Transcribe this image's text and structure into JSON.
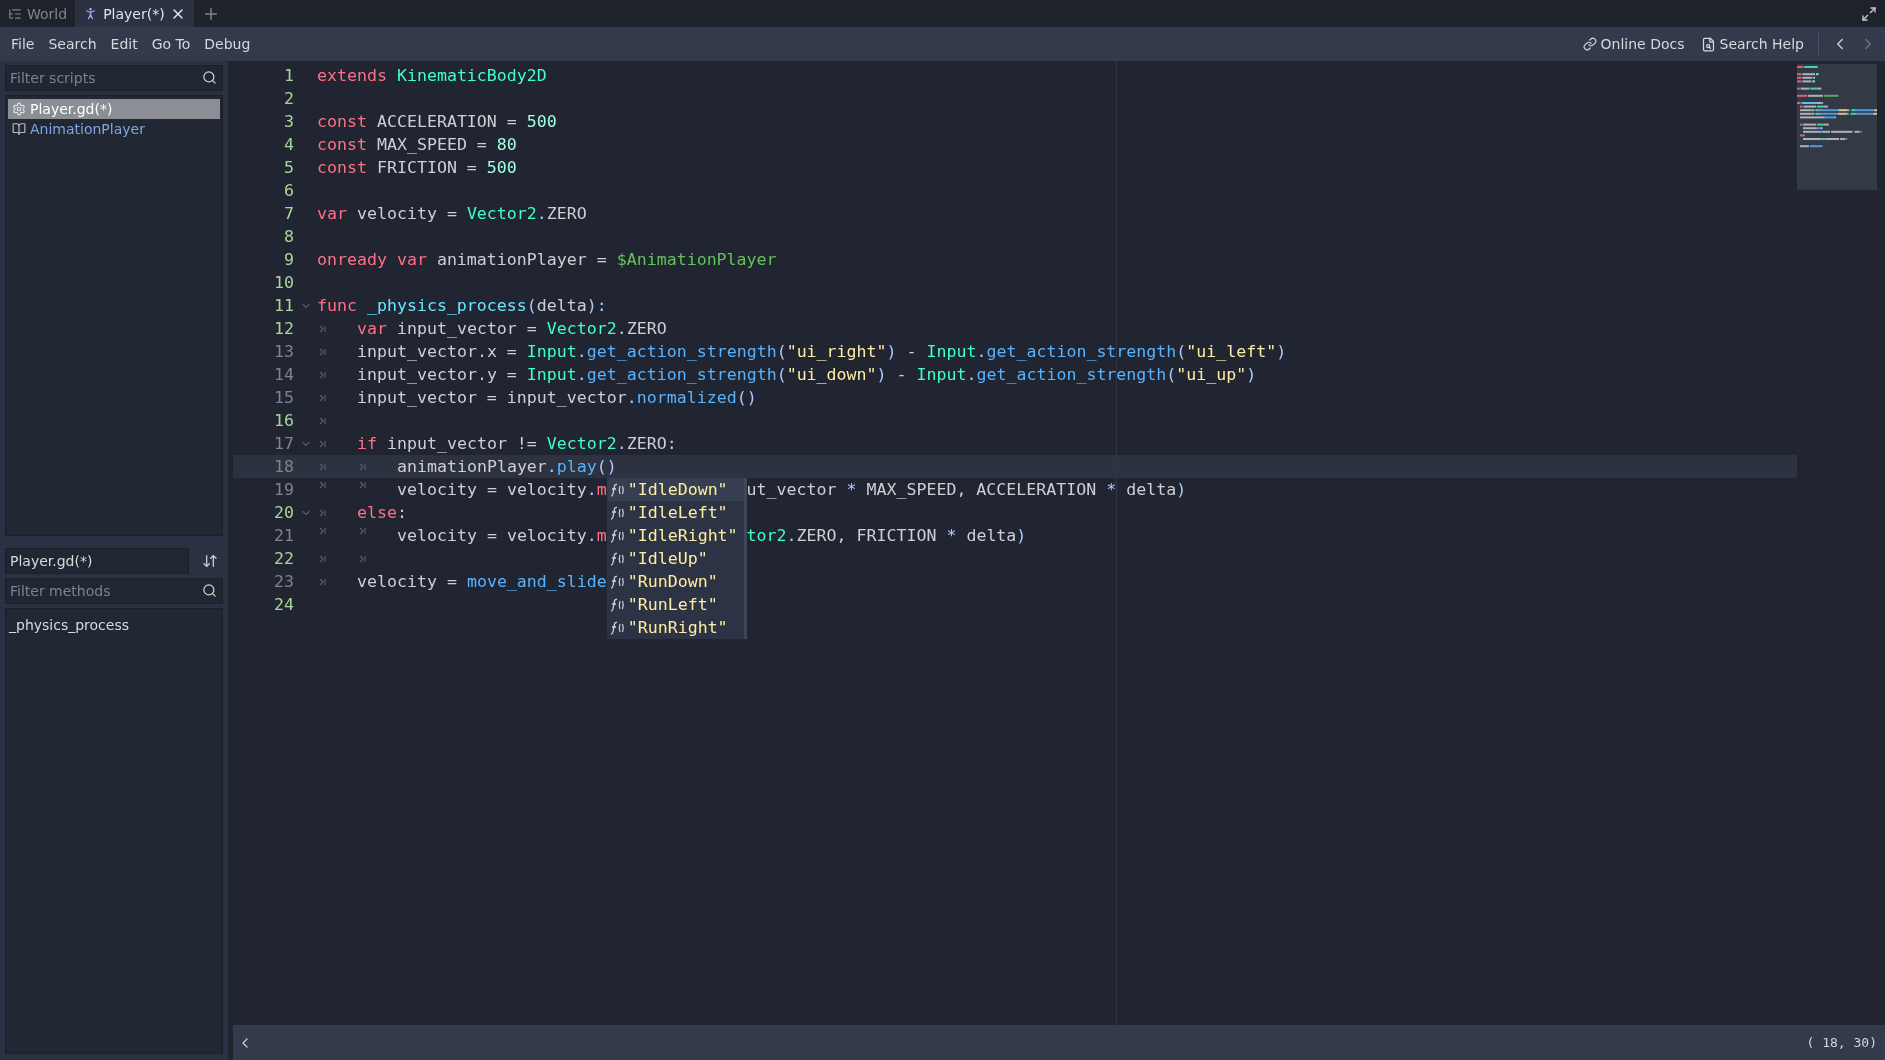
{
  "tabs": [
    {
      "label": "World",
      "kind": "scene3d",
      "selected": false,
      "closable": false
    },
    {
      "label": "Player(*)",
      "kind": "figure",
      "selected": true,
      "closable": true
    }
  ],
  "menu": [
    "File",
    "Search",
    "Edit",
    "Go To",
    "Debug"
  ],
  "help_links": [
    {
      "label": "Online Docs",
      "kind": "link"
    },
    {
      "label": "Search Help",
      "kind": "doc"
    }
  ],
  "scripts": {
    "filter_placeholder": "Filter scripts",
    "items": [
      {
        "label": "Player.gd(*)",
        "kind": "script",
        "selected": true
      },
      {
        "label": "AnimationPlayer",
        "kind": "doc",
        "selected": false
      }
    ]
  },
  "current_script": "Player.gd(*)",
  "methods": {
    "filter_placeholder": "Filter methods",
    "items": [
      {
        "label": "_physics_process",
        "selected": false
      }
    ]
  },
  "code": {
    "lines": [
      {
        "number": "1",
        "safe": true,
        "foldable": false,
        "current": false,
        "tokens": [
          {
            "t": "extends ",
            "kind": "kw"
          },
          {
            "t": "KinematicBody2D",
            "kind": "type"
          }
        ]
      },
      {
        "number": "2",
        "safe": true,
        "foldable": false,
        "current": false
      },
      {
        "number": "3",
        "safe": true,
        "foldable": false,
        "current": false,
        "tokens": [
          {
            "t": "const ",
            "kind": "kw"
          },
          {
            "t": "ACCELERATION = ",
            "kind": "plain"
          },
          {
            "t": "500",
            "kind": "num"
          }
        ]
      },
      {
        "number": "4",
        "safe": true,
        "foldable": false,
        "current": false,
        "tokens": [
          {
            "t": "const ",
            "kind": "kw"
          },
          {
            "t": "MAX_SPEED = ",
            "kind": "plain"
          },
          {
            "t": "80",
            "kind": "num"
          }
        ]
      },
      {
        "number": "5",
        "safe": true,
        "foldable": false,
        "current": false,
        "tokens": [
          {
            "t": "const ",
            "kind": "kw"
          },
          {
            "t": "FRICTION = ",
            "kind": "plain"
          },
          {
            "t": "500",
            "kind": "num"
          }
        ]
      },
      {
        "number": "6",
        "safe": true,
        "foldable": false,
        "current": false
      },
      {
        "number": "7",
        "safe": true,
        "foldable": false,
        "current": false,
        "tokens": [
          {
            "t": "var ",
            "kind": "kw"
          },
          {
            "t": "velocity = ",
            "kind": "plain"
          },
          {
            "t": "Vector2",
            "kind": "type"
          },
          {
            "t": ".",
            "kind": "sym"
          },
          {
            "t": "ZERO",
            "kind": "plain"
          }
        ]
      },
      {
        "number": "8",
        "safe": true,
        "foldable": false,
        "current": false
      },
      {
        "number": "9",
        "safe": true,
        "foldable": false,
        "current": false,
        "tokens": [
          {
            "t": "onready var ",
            "kind": "kw"
          },
          {
            "t": "animationPlayer = ",
            "kind": "plain"
          },
          {
            "t": "$AnimationPlayer",
            "kind": "node"
          }
        ]
      },
      {
        "number": "10",
        "safe": true,
        "foldable": false,
        "current": false
      },
      {
        "number": "11",
        "safe": true,
        "foldable": true,
        "current": false,
        "tokens": [
          {
            "t": "func ",
            "kind": "kw"
          },
          {
            "t": "_physics_process",
            "kind": "fname"
          },
          {
            "t": "(",
            "kind": "sym"
          },
          {
            "t": "delta",
            "kind": "plain"
          },
          {
            "t": "):",
            "kind": "sym"
          }
        ]
      },
      {
        "number": "12",
        "safe": true,
        "foldable": false,
        "current": false,
        "indent": [
          {
            "kind": "tab"
          }
        ],
        "tokens": [
          {
            "t": "var ",
            "kind": "kw"
          },
          {
            "t": "input_vector = ",
            "kind": "plain"
          },
          {
            "t": "Vector2",
            "kind": "type"
          },
          {
            "t": ".",
            "kind": "sym"
          },
          {
            "t": "ZERO",
            "kind": "plain"
          }
        ]
      },
      {
        "number": "13",
        "safe": false,
        "foldable": false,
        "current": false,
        "indent": [
          {
            "kind": "tab"
          }
        ],
        "tokens": [
          {
            "t": "input_vector",
            "kind": "plain"
          },
          {
            "t": ".",
            "kind": "sym"
          },
          {
            "t": "x = ",
            "kind": "plain"
          },
          {
            "t": "Input",
            "kind": "type"
          },
          {
            "t": ".",
            "kind": "sym"
          },
          {
            "t": "get_action_strength",
            "kind": "func"
          },
          {
            "t": "(",
            "kind": "sym"
          },
          {
            "t": "\"ui_right\"",
            "kind": "str"
          },
          {
            "t": ")",
            "kind": "sym"
          },
          {
            "t": " - ",
            "kind": "plain"
          },
          {
            "t": "Input",
            "kind": "type"
          },
          {
            "t": ".",
            "kind": "sym"
          },
          {
            "t": "get_action_strength",
            "kind": "func"
          },
          {
            "t": "(",
            "kind": "sym"
          },
          {
            "t": "\"ui_left\"",
            "kind": "str"
          },
          {
            "t": ")",
            "kind": "sym"
          }
        ]
      },
      {
        "number": "14",
        "safe": false,
        "foldable": false,
        "current": false,
        "indent": [
          {
            "kind": "tab"
          }
        ],
        "tokens": [
          {
            "t": "input_vector",
            "kind": "plain"
          },
          {
            "t": ".",
            "kind": "sym"
          },
          {
            "t": "y = ",
            "kind": "plain"
          },
          {
            "t": "Input",
            "kind": "type"
          },
          {
            "t": ".",
            "kind": "sym"
          },
          {
            "t": "get_action_strength",
            "kind": "func"
          },
          {
            "t": "(",
            "kind": "sym"
          },
          {
            "t": "\"ui_down\"",
            "kind": "str"
          },
          {
            "t": ")",
            "kind": "sym"
          },
          {
            "t": " - ",
            "kind": "plain"
          },
          {
            "t": "Input",
            "kind": "type"
          },
          {
            "t": ".",
            "kind": "sym"
          },
          {
            "t": "get_action_strength",
            "kind": "func"
          },
          {
            "t": "(",
            "kind": "sym"
          },
          {
            "t": "\"ui_up\"",
            "kind": "str"
          },
          {
            "t": ")",
            "kind": "sym"
          }
        ]
      },
      {
        "number": "15",
        "safe": false,
        "foldable": false,
        "current": false,
        "indent": [
          {
            "kind": "tab"
          }
        ],
        "tokens": [
          {
            "t": "input_vector = input_vector",
            "kind": "plain"
          },
          {
            "t": ".",
            "kind": "sym"
          },
          {
            "t": "normalized",
            "kind": "func"
          },
          {
            "t": "()",
            "kind": "sym"
          }
        ]
      },
      {
        "number": "16",
        "safe": true,
        "foldable": false,
        "current": false,
        "indent": [
          {
            "kind": "tab"
          }
        ]
      },
      {
        "number": "17",
        "safe": false,
        "foldable": true,
        "current": false,
        "indent": [
          {
            "kind": "tab"
          }
        ],
        "tokens": [
          {
            "t": "if ",
            "kind": "kw"
          },
          {
            "t": "input_vector != ",
            "kind": "plain"
          },
          {
            "t": "Vector2",
            "kind": "type"
          },
          {
            "t": ".",
            "kind": "sym"
          },
          {
            "t": "ZERO:",
            "kind": "plain"
          }
        ]
      },
      {
        "number": "18",
        "safe": false,
        "foldable": false,
        "current": true,
        "indent": [
          {
            "kind": "tab"
          },
          {
            "kind": "tab"
          }
        ],
        "tokens": [
          {
            "t": "animationPlayer",
            "kind": "plain"
          },
          {
            "t": ".",
            "kind": "sym"
          },
          {
            "t": "play",
            "kind": "func"
          },
          {
            "t": "()",
            "kind": "sym"
          }
        ]
      },
      {
        "number": "19",
        "safe": false,
        "foldable": false,
        "current": false,
        "indent": [
          {
            "kind": "tab"
          },
          {
            "kind": "tab"
          }
        ],
        "tokens": [
          {
            "t": "velocity = velocity",
            "kind": "plain"
          },
          {
            "t": ".",
            "kind": "sym"
          },
          {
            "t": "m",
            "kind": "kw"
          }
        ],
        "tokens_after": [
          {
            "t": "ut_vector ",
            "kind": "plain"
          },
          {
            "t": "*",
            "kind": "sym"
          },
          {
            "t": " MAX_SPEED, ACCELERATION ",
            "kind": "plain"
          },
          {
            "t": "*",
            "kind": "sym"
          },
          {
            "t": " delta",
            "kind": "plain"
          },
          {
            "t": ")",
            "kind": "sym"
          }
        ]
      },
      {
        "number": "20",
        "safe": true,
        "foldable": true,
        "current": false,
        "indent": [
          {
            "kind": "tab"
          }
        ],
        "tokens": [
          {
            "t": "else",
            "kind": "kw"
          },
          {
            "t": ":",
            "kind": "plain"
          }
        ]
      },
      {
        "number": "21",
        "safe": false,
        "foldable": false,
        "current": false,
        "indent": [
          {
            "kind": "tab"
          },
          {
            "kind": "tab"
          }
        ],
        "tokens": [
          {
            "t": "velocity = velocity",
            "kind": "plain"
          },
          {
            "t": ".",
            "kind": "sym"
          },
          {
            "t": "m",
            "kind": "kw"
          }
        ],
        "tokens_after": [
          {
            "t": "tor2",
            "kind": "type"
          },
          {
            "t": ".",
            "kind": "sym"
          },
          {
            "t": "ZERO, FRICTION ",
            "kind": "plain"
          },
          {
            "t": "*",
            "kind": "sym"
          },
          {
            "t": " delta",
            "kind": "plain"
          },
          {
            "t": ")",
            "kind": "sym"
          }
        ]
      },
      {
        "number": "22",
        "safe": true,
        "foldable": false,
        "current": false,
        "indent": [
          {
            "kind": "tab"
          },
          {
            "kind": "tab"
          }
        ]
      },
      {
        "number": "23",
        "safe": false,
        "foldable": false,
        "current": false,
        "indent": [
          {
            "kind": "tab"
          }
        ],
        "tokens": [
          {
            "t": "velocity = ",
            "kind": "plain"
          },
          {
            "t": "move_and_slide",
            "kind": "func"
          }
        ]
      },
      {
        "number": "24",
        "safe": true,
        "foldable": false,
        "current": false
      }
    ]
  },
  "autocomplete": [
    {
      "label": "\"IdleDown\"",
      "selected": true
    },
    {
      "label": "\"IdleLeft\"",
      "selected": false
    },
    {
      "label": "\"IdleRight\"",
      "selected": false
    },
    {
      "label": "\"IdleUp\"",
      "selected": false
    },
    {
      "label": "\"RunDown\"",
      "selected": false
    },
    {
      "label": "\"RunLeft\"",
      "selected": false
    },
    {
      "label": "\"RunRight\"",
      "selected": false
    }
  ],
  "status": {
    "position": "( 18, 30)"
  }
}
